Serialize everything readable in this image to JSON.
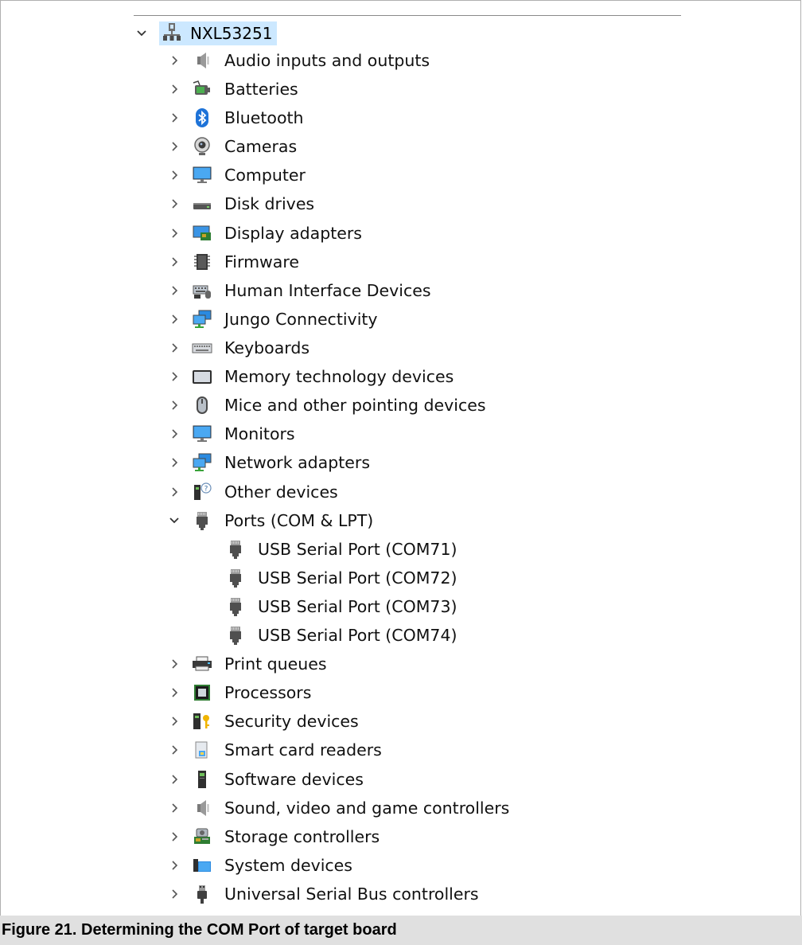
{
  "root": {
    "label": "NXL53251",
    "expanded": true,
    "icon": "computer-network-icon"
  },
  "categories": [
    {
      "label": "Audio inputs and outputs",
      "icon": "speaker-icon",
      "expanded": false
    },
    {
      "label": "Batteries",
      "icon": "battery-icon",
      "expanded": false
    },
    {
      "label": "Bluetooth",
      "icon": "bluetooth-icon",
      "expanded": false
    },
    {
      "label": "Cameras",
      "icon": "webcam-icon",
      "expanded": false
    },
    {
      "label": "Computer",
      "icon": "monitor-icon",
      "expanded": false
    },
    {
      "label": "Disk drives",
      "icon": "disk-drive-icon",
      "expanded": false
    },
    {
      "label": "Display adapters",
      "icon": "display-adapter-icon",
      "expanded": false
    },
    {
      "label": "Firmware",
      "icon": "chip-icon",
      "expanded": false
    },
    {
      "label": "Human Interface Devices",
      "icon": "hid-icon",
      "expanded": false
    },
    {
      "label": "Jungo Connectivity",
      "icon": "network-icon",
      "expanded": false
    },
    {
      "label": "Keyboards",
      "icon": "keyboard-icon",
      "expanded": false
    },
    {
      "label": "Memory technology devices",
      "icon": "memory-icon",
      "expanded": false
    },
    {
      "label": "Mice and other pointing devices",
      "icon": "mouse-icon",
      "expanded": false
    },
    {
      "label": "Monitors",
      "icon": "monitor-icon",
      "expanded": false
    },
    {
      "label": "Network adapters",
      "icon": "network-icon",
      "expanded": false
    },
    {
      "label": "Other devices",
      "icon": "unknown-device-icon",
      "expanded": false
    },
    {
      "label": "Ports (COM & LPT)",
      "icon": "port-icon",
      "expanded": true,
      "children": [
        {
          "label": "USB Serial Port (COM71)",
          "icon": "port-icon"
        },
        {
          "label": "USB Serial Port (COM72)",
          "icon": "port-icon"
        },
        {
          "label": "USB Serial Port (COM73)",
          "icon": "port-icon"
        },
        {
          "label": "USB Serial Port (COM74)",
          "icon": "port-icon"
        }
      ]
    },
    {
      "label": "Print queues",
      "icon": "printer-icon",
      "expanded": false
    },
    {
      "label": "Processors",
      "icon": "processor-icon",
      "expanded": false
    },
    {
      "label": "Security devices",
      "icon": "security-key-icon",
      "expanded": false
    },
    {
      "label": "Smart card readers",
      "icon": "smart-card-icon",
      "expanded": false
    },
    {
      "label": "Software devices",
      "icon": "software-device-icon",
      "expanded": false
    },
    {
      "label": "Sound, video and game controllers",
      "icon": "speaker-icon",
      "expanded": false
    },
    {
      "label": "Storage controllers",
      "icon": "storage-controller-icon",
      "expanded": false
    },
    {
      "label": "System devices",
      "icon": "system-folder-icon",
      "expanded": false
    },
    {
      "label": "Universal Serial Bus controllers",
      "icon": "usb-icon",
      "expanded": false
    }
  ],
  "caption": "Figure 21.  Determining the COM Port of target board"
}
